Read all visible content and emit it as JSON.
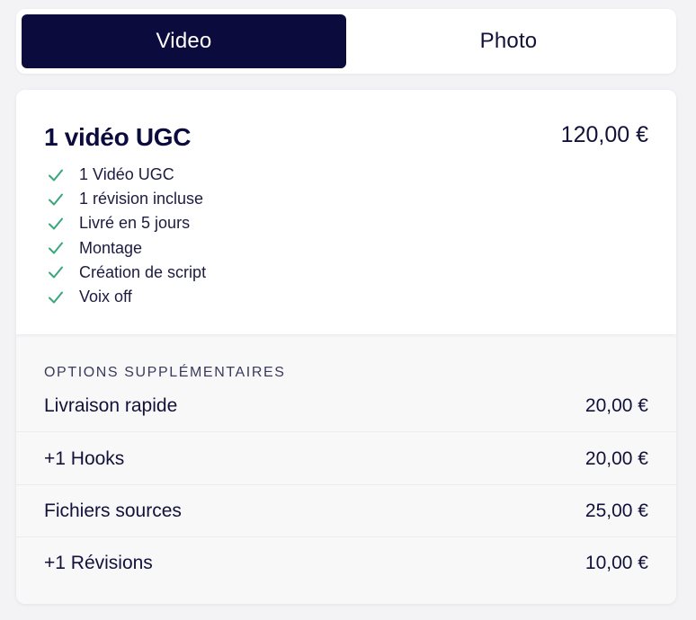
{
  "tabs": [
    {
      "label": "Video",
      "active": true
    },
    {
      "label": "Photo",
      "active": false
    }
  ],
  "plan": {
    "title": "1 vidéo UGC",
    "price": "120,00 €",
    "features": [
      "1 Vidéo UGC",
      "1 révision incluse",
      "Livré en 5 jours",
      "Montage",
      "Création de script",
      "Voix off"
    ],
    "check_icon": "check-icon",
    "check_color": "#3aa77a"
  },
  "options": {
    "heading": "OPTIONS SUPPLÉMENTAIRES",
    "items": [
      {
        "label": "Livraison rapide",
        "price": "20,00 €"
      },
      {
        "label": "+1 Hooks",
        "price": "20,00 €"
      },
      {
        "label": "Fichiers sources",
        "price": "25,00 €"
      },
      {
        "label": "+1 Révisions",
        "price": "10,00 €"
      }
    ]
  },
  "colors": {
    "accent": "#0c0b3d",
    "background": "#f3f3f6",
    "options_background": "#f8f8f9"
  }
}
